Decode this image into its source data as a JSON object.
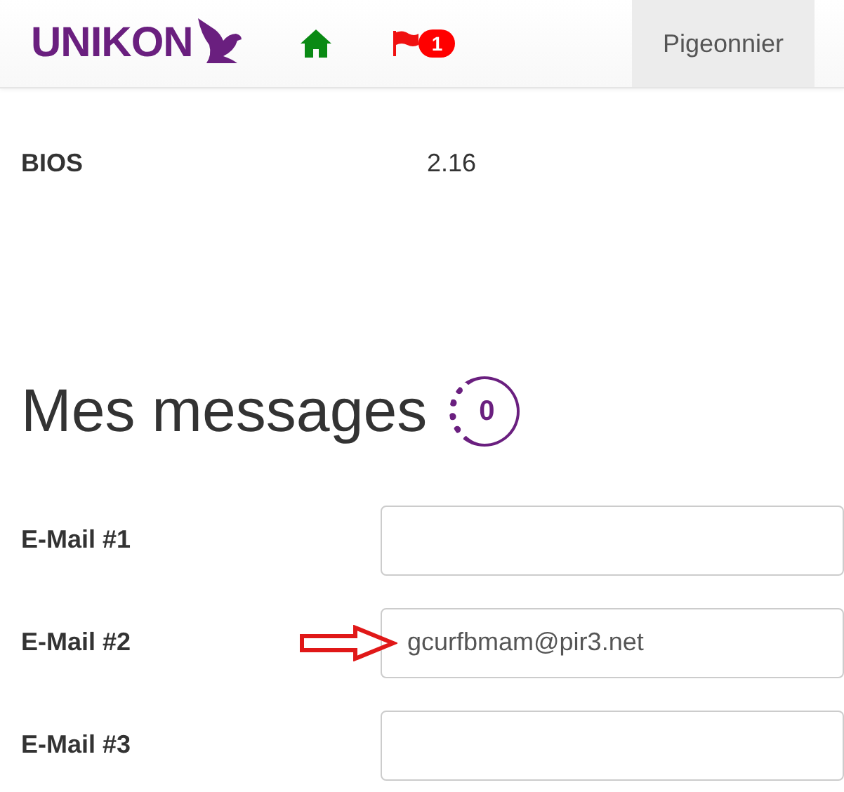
{
  "navbar": {
    "brand": "UNIKON",
    "flag_badge": "1",
    "tabs": [
      {
        "label": "Pigeonnier",
        "selected": true
      }
    ]
  },
  "info": [
    {
      "label": "BIOS",
      "value": "2.16"
    }
  ],
  "messages": {
    "title": "Mes messages",
    "count": "0"
  },
  "emails": [
    {
      "label": "E-Mail #1",
      "arrow": false
    },
    {
      "label": "E-Mail #2",
      "value": "gcurfbmam@pir3.net",
      "arrow": true
    },
    {
      "label": "E-Mail #3",
      "arrow": false
    }
  ]
}
